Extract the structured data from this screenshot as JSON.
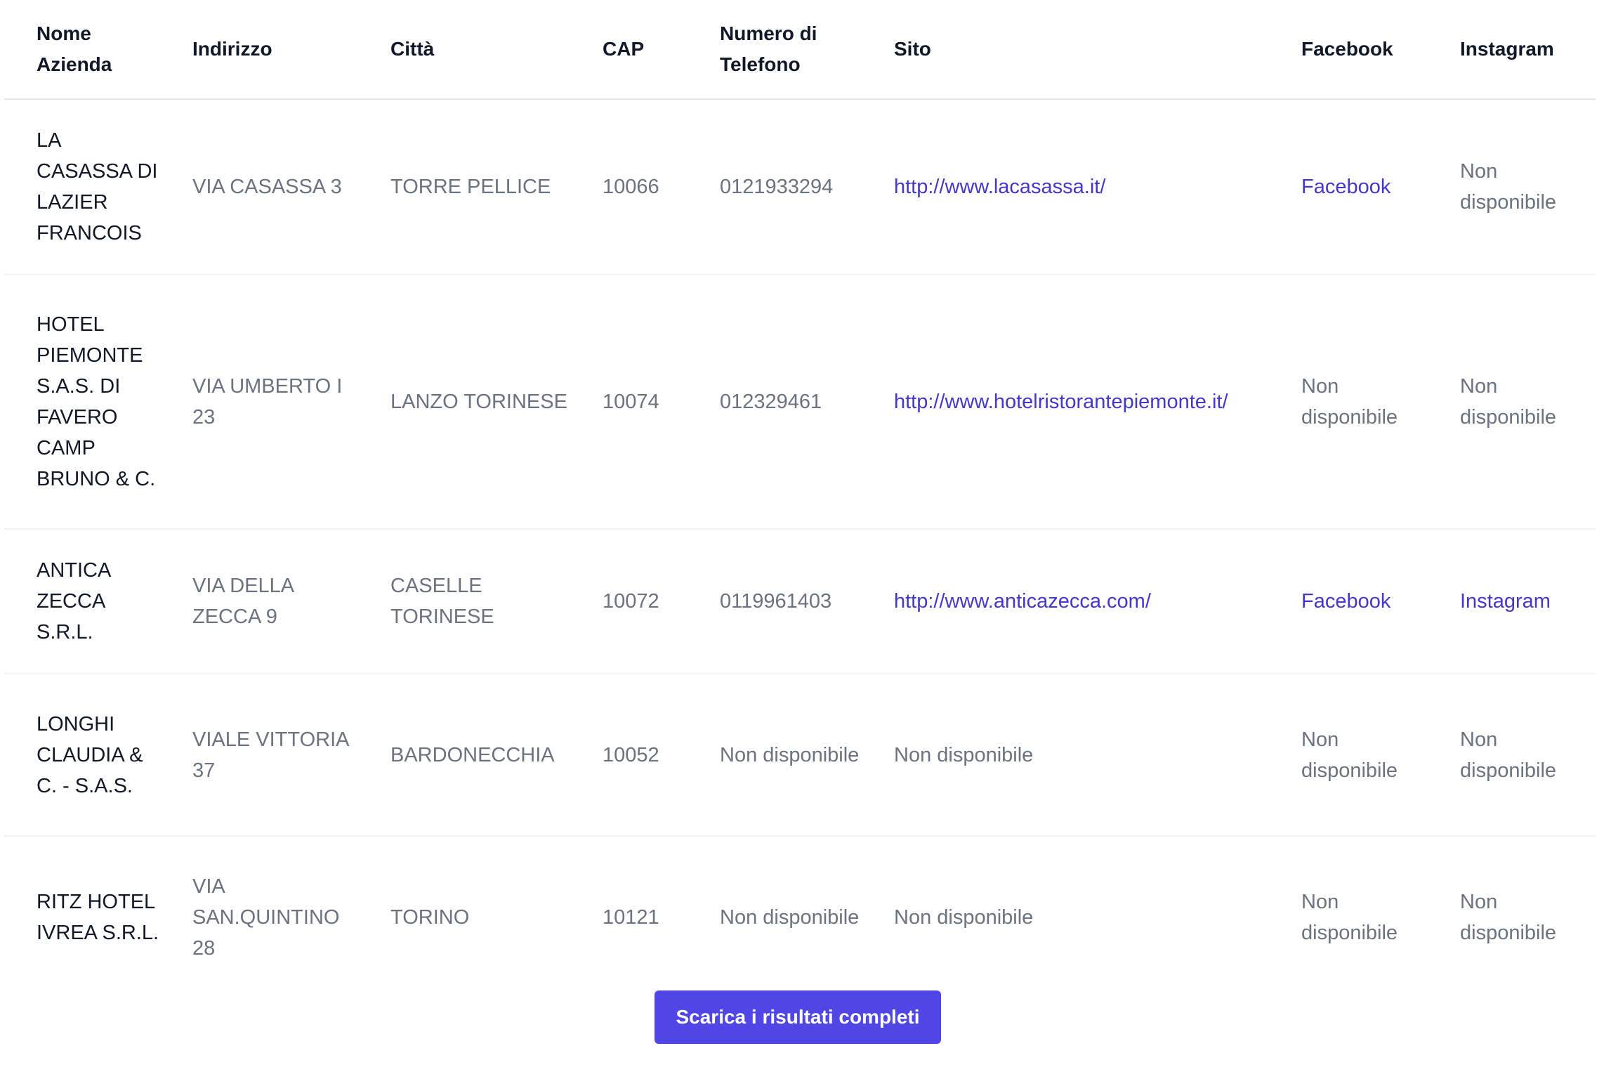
{
  "table": {
    "headers": {
      "nome_azienda": "Nome Azienda",
      "indirizzo": "Indirizzo",
      "citta": "Città",
      "cap": "CAP",
      "numero_di_telefono": "Numero di Telefono",
      "sito": "Sito",
      "facebook": "Facebook",
      "instagram": "Instagram"
    },
    "rows": [
      {
        "nome_azienda": "LA CASASSA DI LAZIER FRANCOIS",
        "indirizzo": "VIA CASASSA 3",
        "citta": "TORRE PELLICE",
        "cap": "10066",
        "telefono": "0121933294",
        "sito": "http://www.lacasassa.it/",
        "facebook": "Facebook",
        "instagram": "Non disponibile"
      },
      {
        "nome_azienda": "HOTEL PIEMONTE S.A.S. DI FAVERO CAMP BRUNO & C.",
        "indirizzo": "VIA UMBERTO I 23",
        "citta": "LANZO TORINESE",
        "cap": "10074",
        "telefono": "012329461",
        "sito": "http://www.hotelristorantepiemonte.it/",
        "facebook": "Non disponibile",
        "instagram": "Non disponibile"
      },
      {
        "nome_azienda": "ANTICA ZECCA S.R.L.",
        "indirizzo": "VIA DELLA ZECCA 9",
        "citta": "CASELLE TORINESE",
        "cap": "10072",
        "telefono": "0119961403",
        "sito": "http://www.anticazecca.com/",
        "facebook": "Facebook",
        "instagram": "Instagram"
      },
      {
        "nome_azienda": "LONGHI CLAUDIA & C. - S.A.S.",
        "indirizzo": "VIALE VITTORIA 37",
        "citta": "BARDONECCHIA",
        "cap": "10052",
        "telefono": "Non disponibile",
        "sito": "Non disponibile",
        "facebook": "Non disponibile",
        "instagram": "Non disponibile"
      },
      {
        "nome_azienda": "RITZ HOTEL IVREA S.R.L.",
        "indirizzo": "VIA SAN.QUINTINO 28",
        "citta": "TORINO",
        "cap": "10121",
        "telefono": "Non disponibile",
        "sito": "Non disponibile",
        "facebook": "Non disponibile",
        "instagram": "Non disponibile"
      }
    ]
  },
  "download_button": {
    "label": "Scarica i risultati completi"
  },
  "colors": {
    "link": "#4338ca",
    "button_background": "#4f46e5",
    "button_text": "#ffffff",
    "header_text": "#111827",
    "cell_text": "#6b7280"
  }
}
